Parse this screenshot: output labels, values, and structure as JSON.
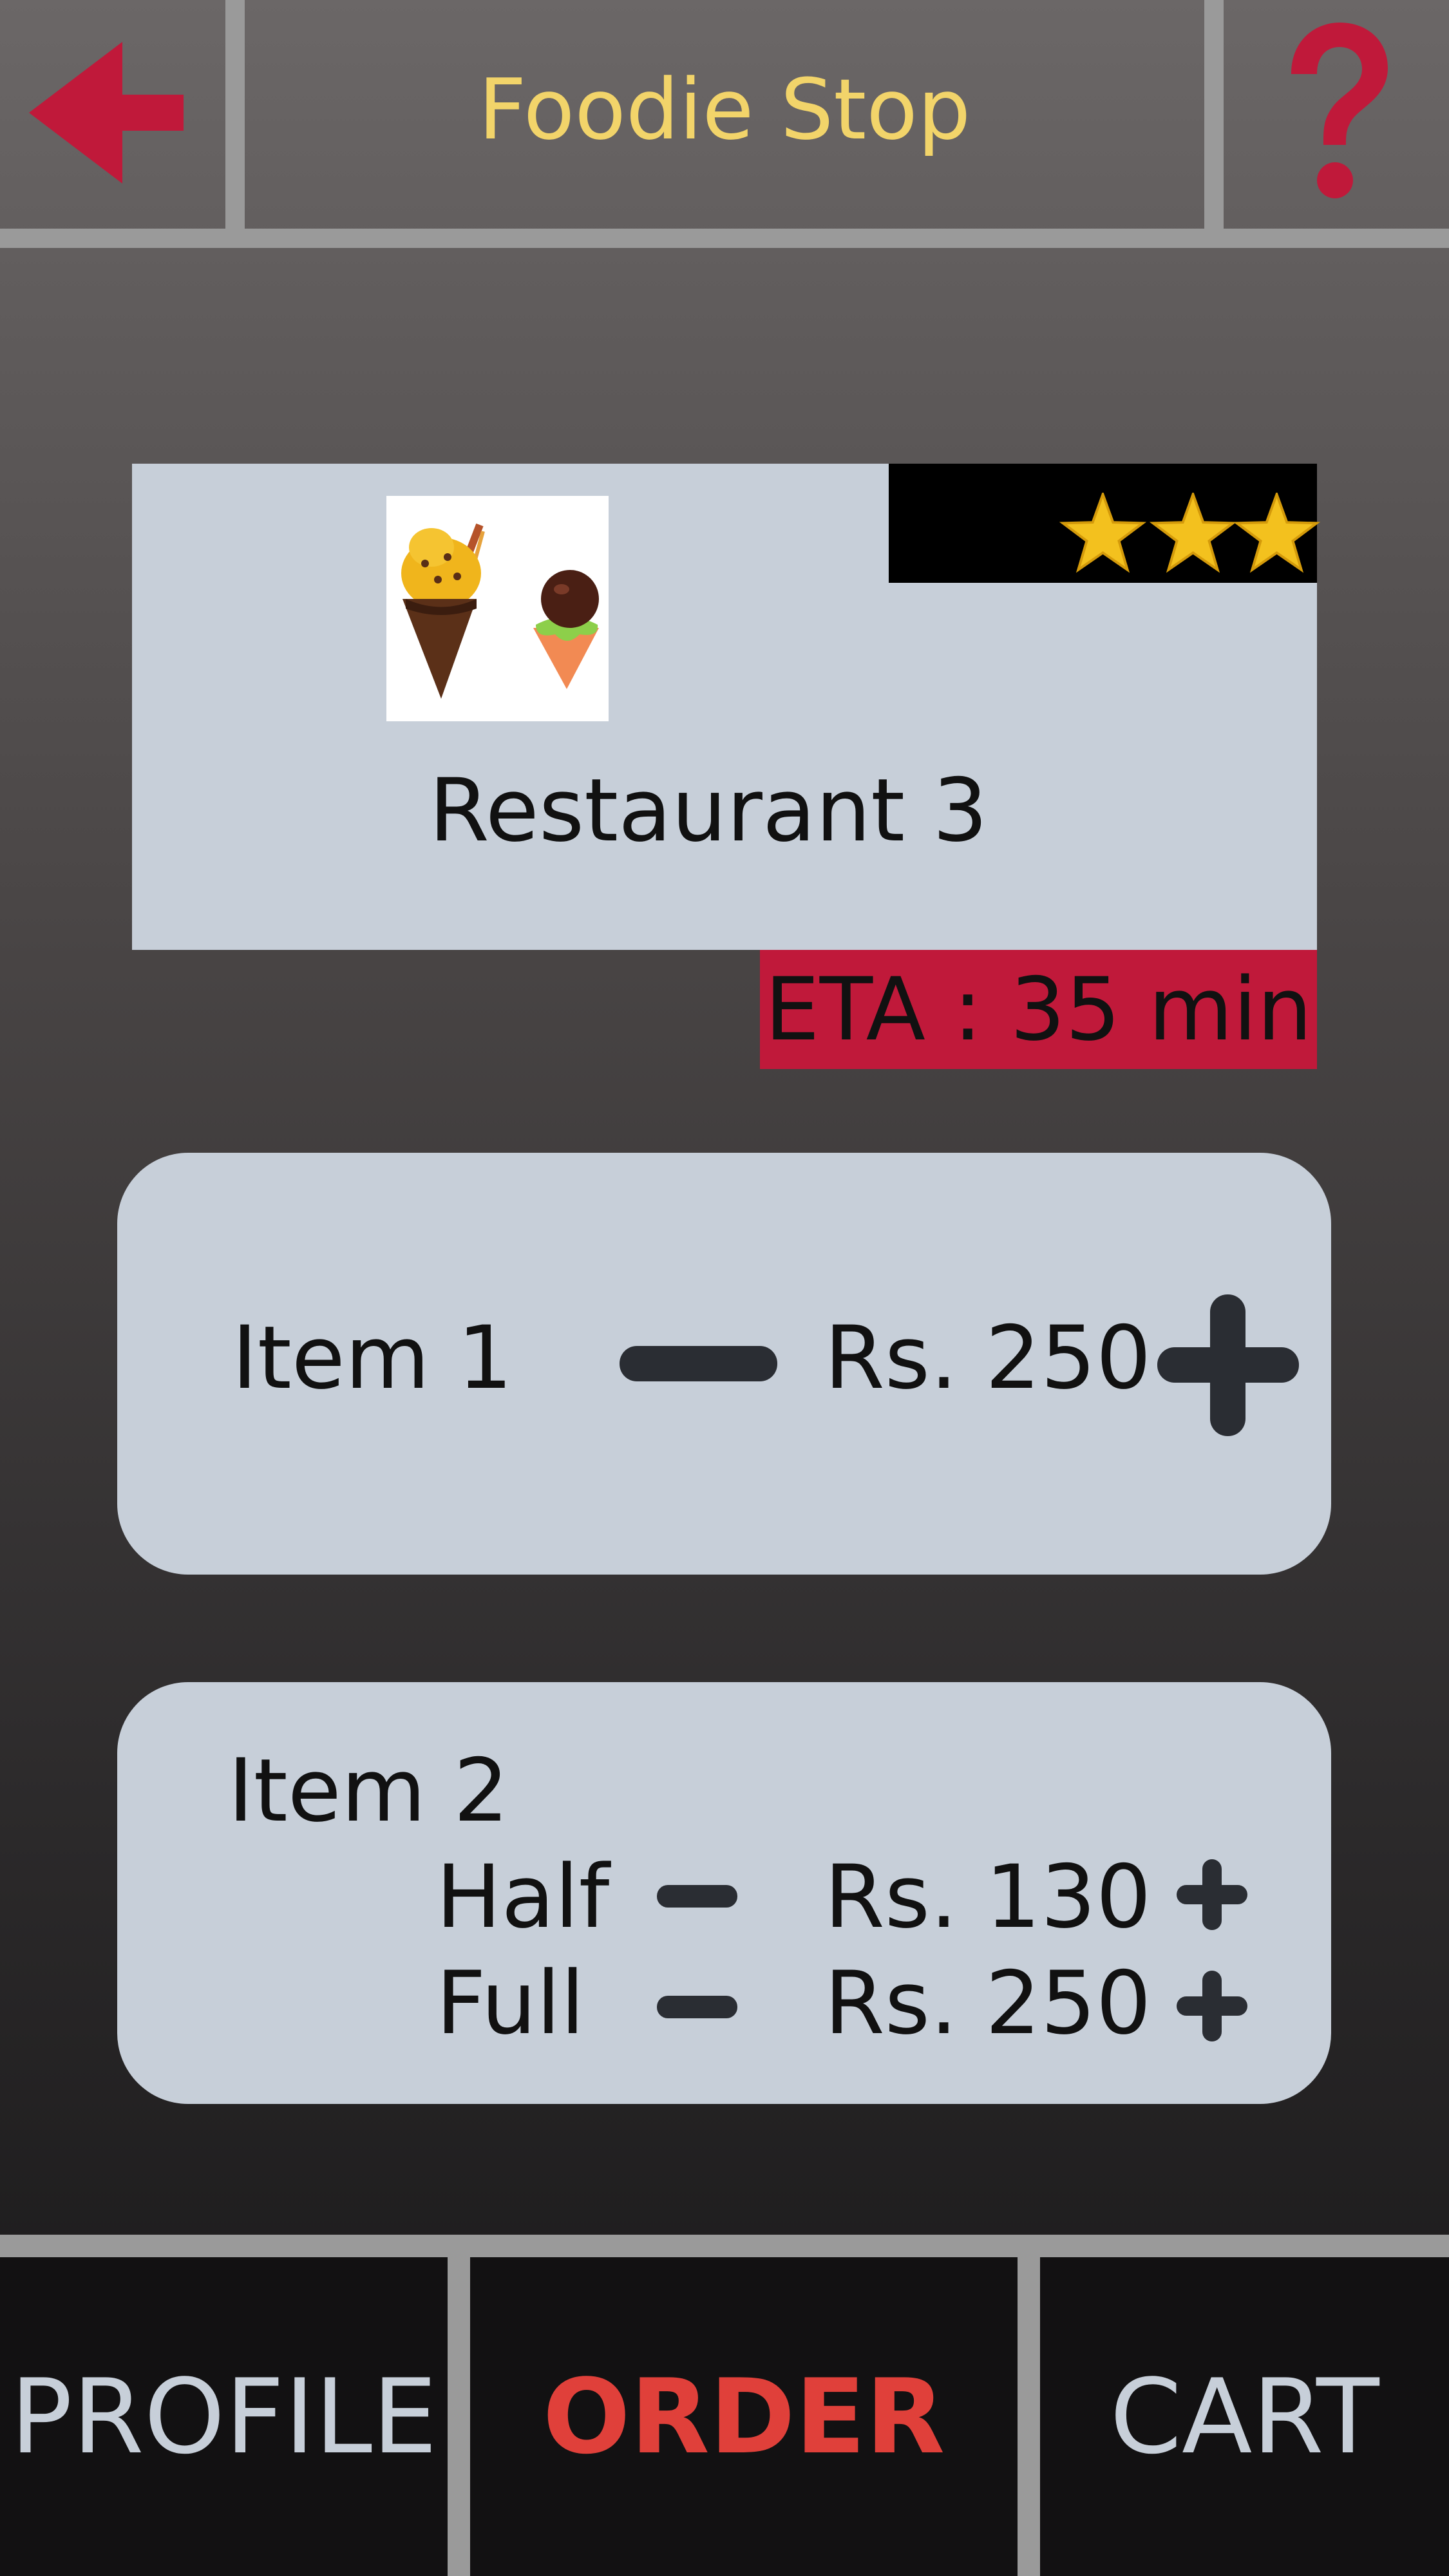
{
  "header": {
    "title": "Foodie Stop",
    "back_icon": "arrow-left-icon",
    "help_icon": "question-mark-icon"
  },
  "restaurant": {
    "name": "Restaurant 3",
    "rating_stars": 3,
    "eta": "ETA : 35 min",
    "image": "ice-cream-cones"
  },
  "items": [
    {
      "name": "Item 1",
      "price": "Rs. 250"
    },
    {
      "name": "Item 2",
      "variants": [
        {
          "size": "Half",
          "price": "Rs. 130"
        },
        {
          "size": "Full",
          "price": "Rs. 250"
        }
      ]
    }
  ],
  "nav": {
    "profile": "PROFILE",
    "order": "ORDER",
    "cart": "CART",
    "active": "ORDER"
  },
  "colors": {
    "title": "#f2d46a",
    "accent_red": "#c0193a",
    "card_bg": "#c7cfd9",
    "star": "#f3c11e",
    "active_tab": "#e0403a"
  }
}
